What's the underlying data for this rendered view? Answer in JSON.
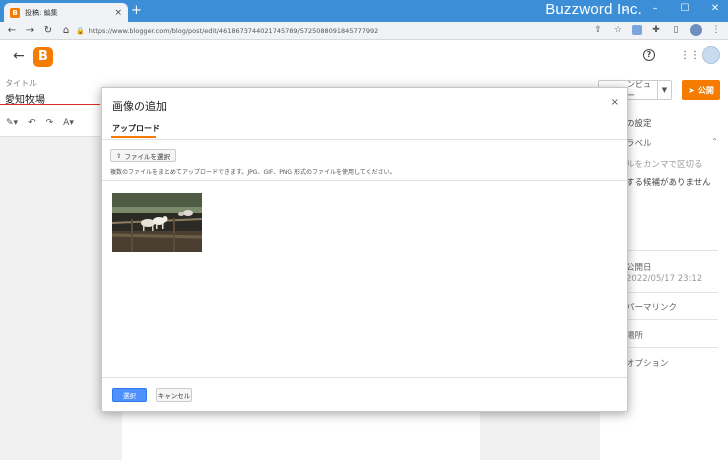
{
  "browser": {
    "tab_title": "投稿: 編集",
    "tab_close": "×",
    "new_tab": "+",
    "brand": "Buzzword Inc.",
    "url": "https://www.blogger.com/blog/post/edit/4618673744021745789/5725088091845777992"
  },
  "page": {
    "title_label": "タイトル",
    "title_value": "愛知牧場",
    "preview_label": "ンビュー",
    "publish_label": "公開",
    "sidebar": {
      "settings": "の設定",
      "labels": "ラベル",
      "labels_hint": "ルをカンマで区切る",
      "labels_suggest": "する候補がありません",
      "publish_date_label": "公開日",
      "publish_date_value": "2022/05/17 23:12",
      "permalink": "パーマリンク",
      "location": "場所",
      "options": "オプション"
    }
  },
  "modal": {
    "title": "画像の追加",
    "close": "×",
    "tab_upload": "アップロード",
    "select_file_label": "ファイルを選択",
    "upload_hint": "複数のファイルをまとめてアップロードできます。JPG、GIF、PNG 形式のファイルを使用してください。",
    "ok_label": "選択",
    "cancel_label": "キャンセル"
  },
  "colors": {
    "accent": "#f57c00",
    "primary_button": "#4d90fe",
    "titlebar": "#3c8fd6"
  }
}
